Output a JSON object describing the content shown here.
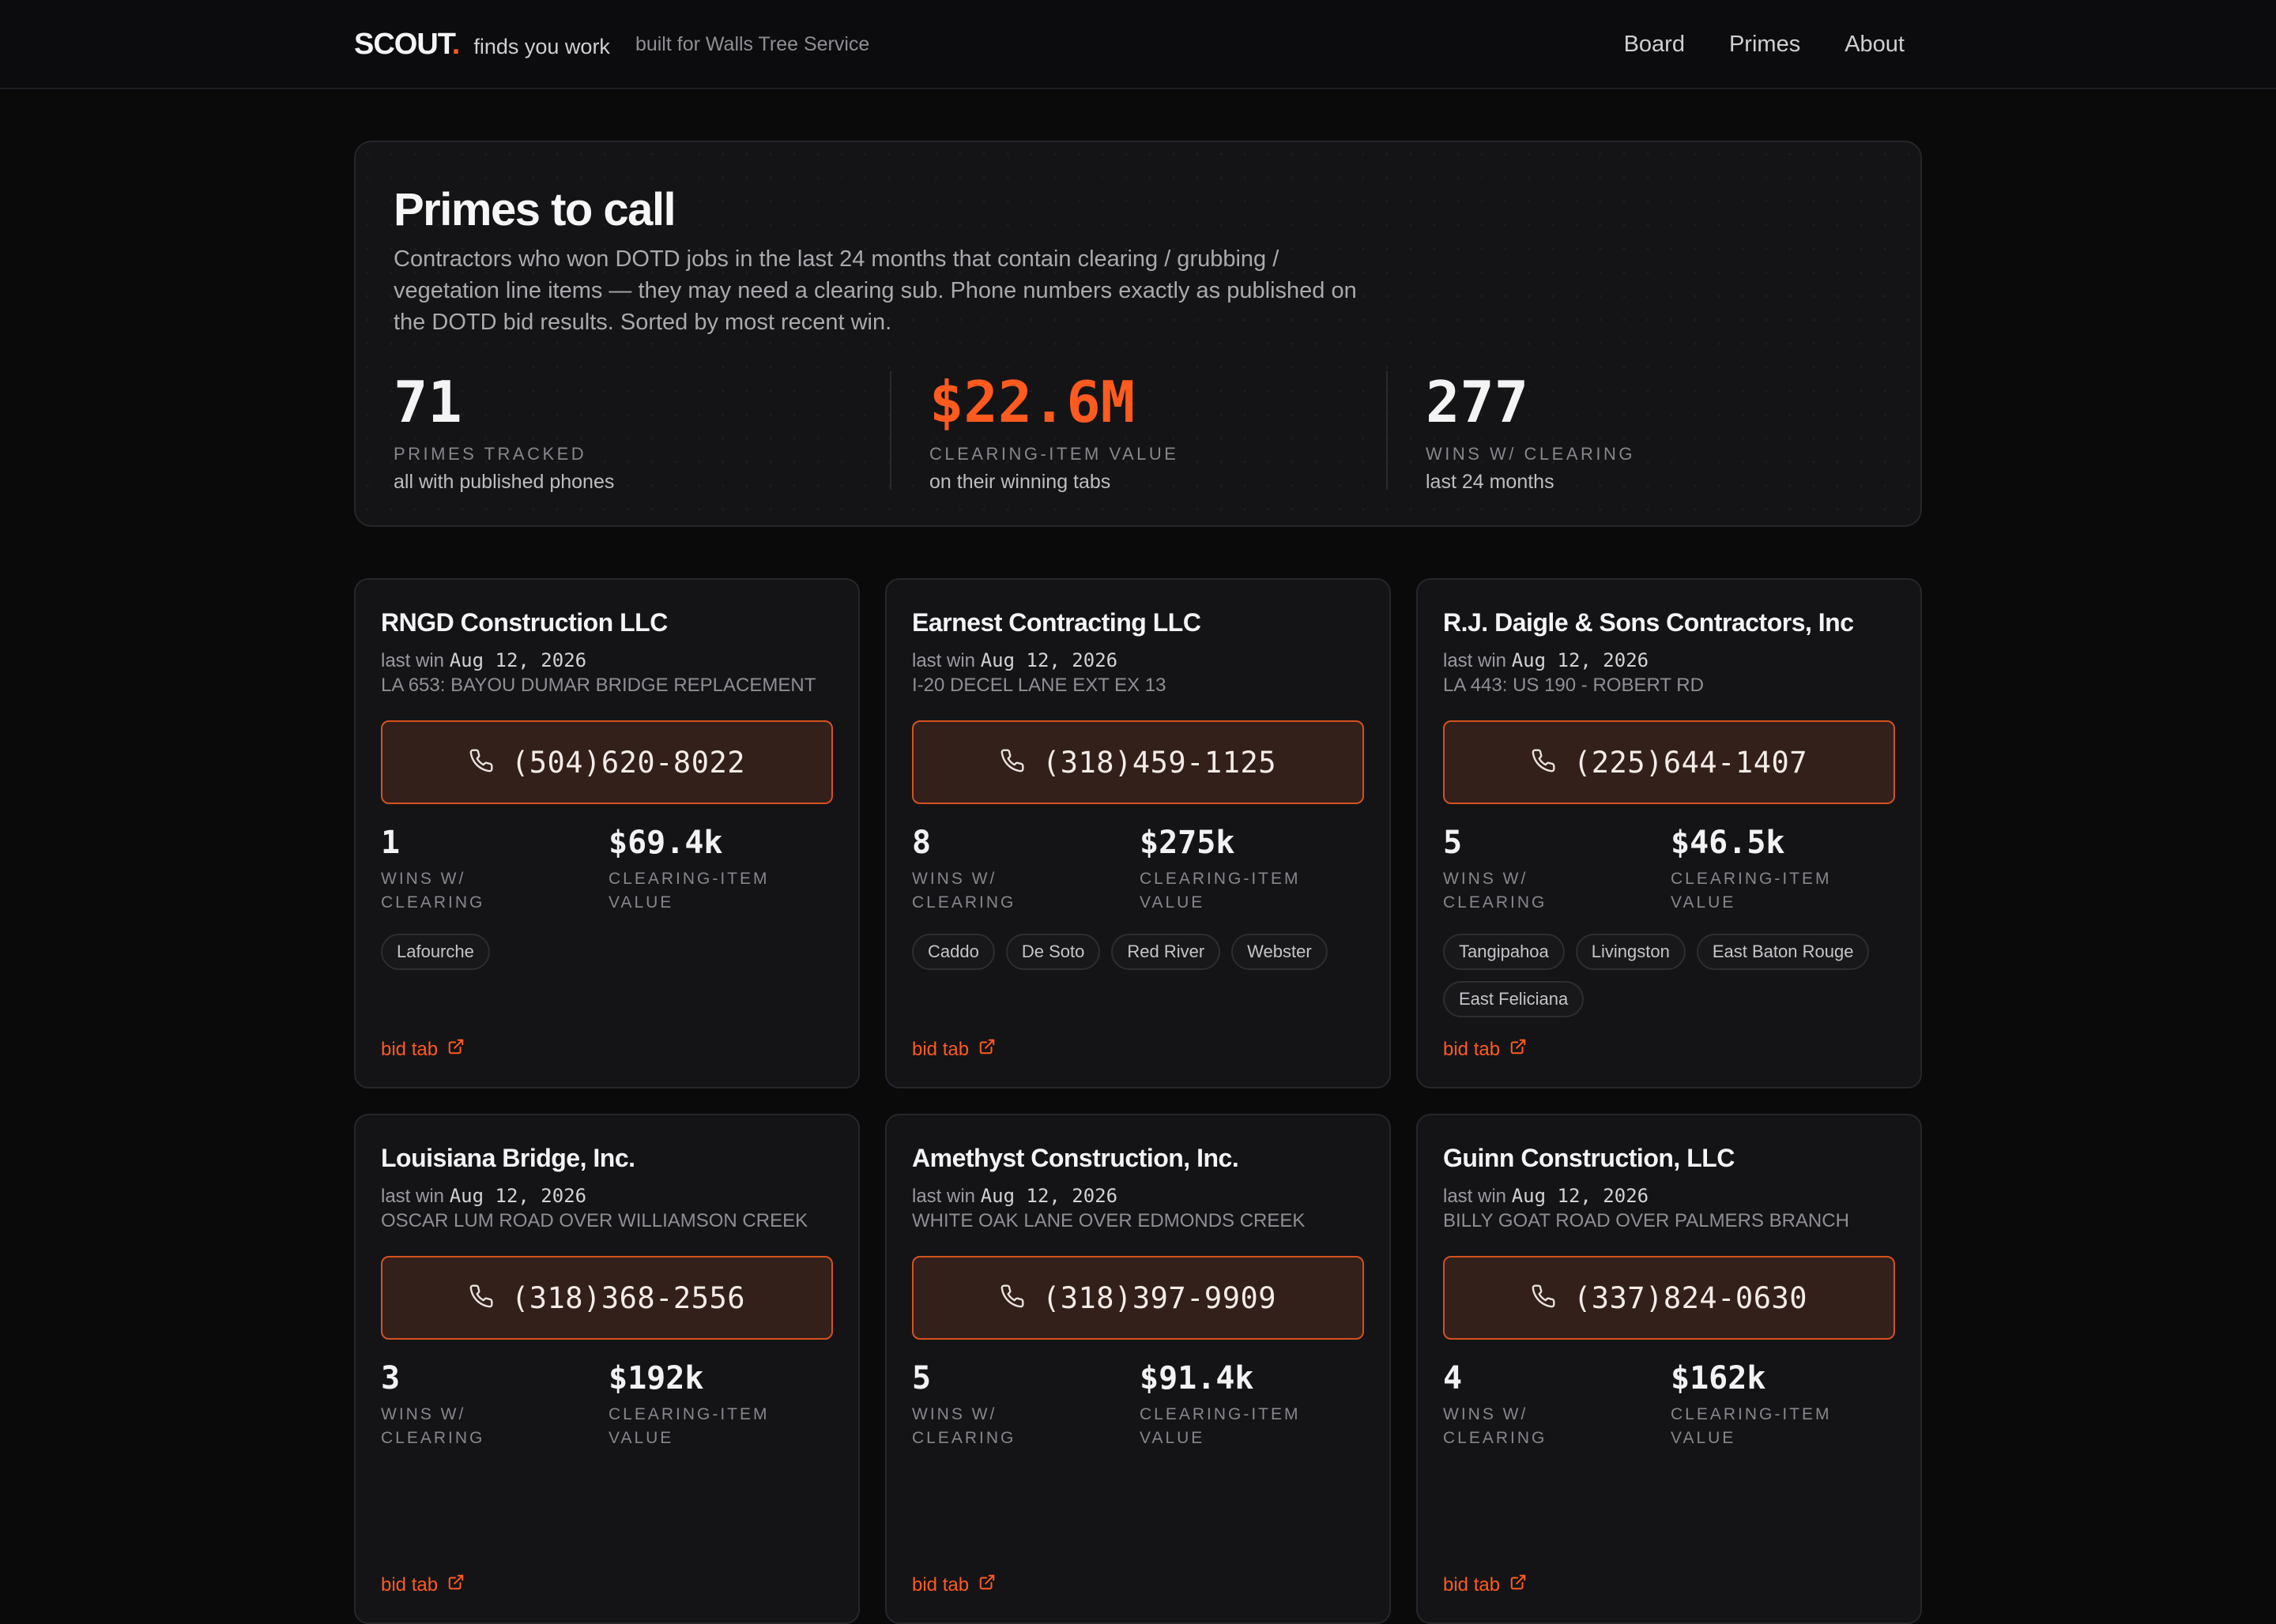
{
  "header": {
    "brand": "SCOUT",
    "brand_dot": ".",
    "tagline": "finds you work",
    "built_for": "built for Walls Tree Service",
    "nav": [
      "Board",
      "Primes",
      "About"
    ]
  },
  "hero": {
    "title": "Primes to call",
    "description": "Contractors who won DOTD jobs in the last 24 months that contain clearing / grubbing / vegetation line items — they may need a clearing sub. Phone numbers exactly as published on the DOTD bid results. Sorted by most recent win.",
    "stats": [
      {
        "value": "71",
        "label": "PRIMES TRACKED",
        "sub": "all with published phones"
      },
      {
        "value": "$22.6M",
        "label": "CLEARING-ITEM VALUE",
        "sub": "on their winning tabs"
      },
      {
        "value": "277",
        "label": "WINS W/ CLEARING",
        "sub": "last 24 months"
      }
    ]
  },
  "card_labels": {
    "last_win": "last win",
    "wins_label": "WINS W/\nCLEARING",
    "value_label": "CLEARING-ITEM\nVALUE",
    "bid_tab": "bid tab"
  },
  "primes": [
    {
      "name": "RNGD Construction LLC",
      "last_win": "Aug 12, 2026",
      "job": "LA 653: BAYOU DUMAR BRIDGE REPLACEMENT",
      "phone": "(504)620-8022",
      "wins": "1",
      "value": "$69.4k",
      "parishes": [
        "Lafourche"
      ]
    },
    {
      "name": "Earnest Contracting LLC",
      "last_win": "Aug 12, 2026",
      "job": "I-20 DECEL LANE EXT EX 13",
      "phone": "(318)459-1125",
      "wins": "8",
      "value": "$275k",
      "parishes": [
        "Caddo",
        "De Soto",
        "Red River",
        "Webster"
      ]
    },
    {
      "name": "R.J. Daigle & Sons Contractors, Inc",
      "last_win": "Aug 12, 2026",
      "job": "LA 443: US 190 - ROBERT RD",
      "phone": "(225)644-1407",
      "wins": "5",
      "value": "$46.5k",
      "parishes": [
        "Tangipahoa",
        "Livingston",
        "East Baton Rouge",
        "East Feliciana"
      ]
    },
    {
      "name": "Louisiana Bridge, Inc.",
      "last_win": "Aug 12, 2026",
      "job": "OSCAR LUM ROAD OVER WILLIAMSON CREEK",
      "phone": "(318)368-2556",
      "wins": "3",
      "value": "$192k",
      "parishes": []
    },
    {
      "name": "Amethyst Construction, Inc.",
      "last_win": "Aug 12, 2026",
      "job": "WHITE OAK LANE OVER EDMONDS CREEK",
      "phone": "(318)397-9909",
      "wins": "5",
      "value": "$91.4k",
      "parishes": []
    },
    {
      "name": "Guinn Construction, LLC",
      "last_win": "Aug 12, 2026",
      "job": "BILLY GOAT ROAD OVER PALMERS BRANCH",
      "phone": "(337)824-0630",
      "wins": "4",
      "value": "$162k",
      "parishes": []
    }
  ],
  "colors": {
    "accent": "#ff5a1f",
    "phone_bg": "#33201b",
    "card_bg": "#141417",
    "page_bg": "#0a0a0b"
  }
}
